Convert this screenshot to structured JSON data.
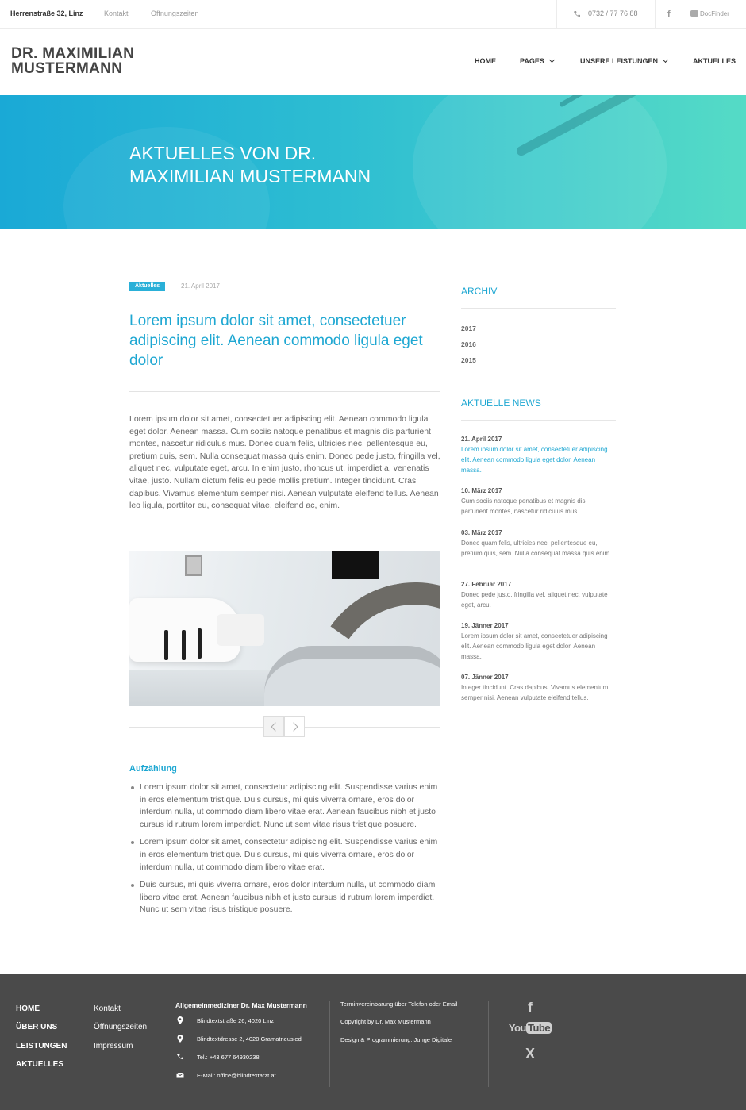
{
  "topbar": {
    "address": "Herrenstraße 32, Linz",
    "links": [
      "Kontakt",
      "Öffnungszeiten"
    ],
    "phone": "0732 / 77 76 88",
    "facebook": "f",
    "docfinder": "DocFinder"
  },
  "header": {
    "logo_line1": "DR. MAXIMILIAN",
    "logo_line2": "MUSTERMANN",
    "nav": [
      "HOME",
      "PAGES",
      "UNSERE LEISTUNGEN",
      "AKTUELLES"
    ]
  },
  "hero": {
    "title_line1": "AKTUELLES VON DR.",
    "title_line2": "MAXIMILIAN MUSTERMANN"
  },
  "article": {
    "tag": "Aktuelles",
    "date": "21. April 2017",
    "title": "Lorem ipsum dolor sit amet, consectetuer adipiscing elit. Aenean commodo ligula eget dolor",
    "body": "Lorem ipsum dolor sit amet, consectetuer adipiscing elit. Aenean commodo ligula eget dolor. Aenean massa. Cum sociis natoque penatibus et magnis dis parturient montes, nascetur ridiculus mus. Donec quam felis, ultricies nec, pellentesque eu, pretium quis, sem. Nulla consequat massa quis enim. Donec pede justo, fringilla vel, aliquet nec, vulputate eget, arcu. In enim justo, rhoncus ut, imperdiet a, venenatis vitae, justo. Nullam dictum felis eu pede mollis pretium. Integer tincidunt. Cras dapibus. Vivamus elementum semper nisi. Aenean vulputate eleifend tellus. Aenean leo ligula, porttitor eu, consequat vitae, eleifend ac, enim.",
    "subheading": "Aufzählung",
    "list": [
      "Lorem ipsum dolor sit amet, consectetur adipiscing elit. Suspendisse varius enim in eros elementum tristique. Duis cursus, mi quis viverra ornare, eros dolor interdum nulla, ut commodo diam libero vitae erat. Aenean faucibus nibh et justo cursus id rutrum lorem imperdiet. Nunc ut sem vitae risus tristique posuere.",
      "Lorem ipsum dolor sit amet, consectetur adipiscing elit. Suspendisse varius enim in eros elementum tristique. Duis cursus, mi quis viverra ornare, eros dolor interdum nulla, ut commodo diam libero vitae erat.",
      "Duis cursus, mi quis viverra ornare, eros dolor interdum nulla, ut commodo diam libero vitae erat. Aenean faucibus nibh et justo cursus id rutrum lorem imperdiet. Nunc ut sem vitae risus tristique posuere."
    ]
  },
  "sidebar": {
    "archive_heading": "ARCHIV",
    "years": [
      "2017",
      "2016",
      "2015"
    ],
    "news_heading": "AKTUELLE NEWS",
    "news": [
      {
        "date": "21. April 2017",
        "text": "Lorem ipsum dolor sit amet, consectetuer adipiscing elit. Aenean commodo ligula eget dolor. Aenean massa."
      },
      {
        "date": "10. März 2017",
        "text": "Cum sociis natoque penatibus et magnis dis parturient montes, nascetur ridiculus mus."
      },
      {
        "date": "03. März 2017",
        "text": "Donec quam felis, ultricies nec, pellentesque eu, pretium quis, sem. Nulla consequat massa quis enim."
      },
      {
        "date": "27. Februar 2017",
        "text": "Donec pede justo, fringilla vel, aliquet nec, vulputate eget, arcu."
      },
      {
        "date": "19. Jänner 2017",
        "text": "Lorem ipsum dolor sit amet, consectetuer adipiscing elit. Aenean commodo ligula eget dolor. Aenean massa."
      },
      {
        "date": "07. Jänner 2017",
        "text": "Integer tincidunt. Cras dapibus. Vivamus elementum semper nisi. Aenean vulputate eleifend tellus."
      }
    ]
  },
  "footer": {
    "nav": [
      "HOME",
      "ÜBER UNS",
      "LEISTUNGEN",
      "AKTUELLES"
    ],
    "links": [
      "Kontakt",
      "Öffnungszeiten",
      "Impressum"
    ],
    "practice_name": "Allgemeinmediziner Dr. Max Mustermann",
    "address1": "Blindtextstraße 26, 4020 Linz",
    "address2": "Blindtextdresse 2, 4020 Gramatneusiedl",
    "phone": "Tel.: +43 677 64930238",
    "email": "E-Mail: office@blindtextarzt.at",
    "info": [
      "Terminvereinbarung über Telefon oder Email",
      "Copyright by Dr. Max Mustermann",
      "Design & Programmierung: Junge Digitale"
    ],
    "social": {
      "facebook": "f",
      "youtube_you": "You",
      "youtube_tube": "Tube",
      "xing": "X"
    }
  },
  "colors": {
    "accent": "#1ea7d2",
    "footer_bg": "#4a4a4a",
    "hero_start": "#1aa9d6",
    "hero_end": "#55dbc6"
  }
}
